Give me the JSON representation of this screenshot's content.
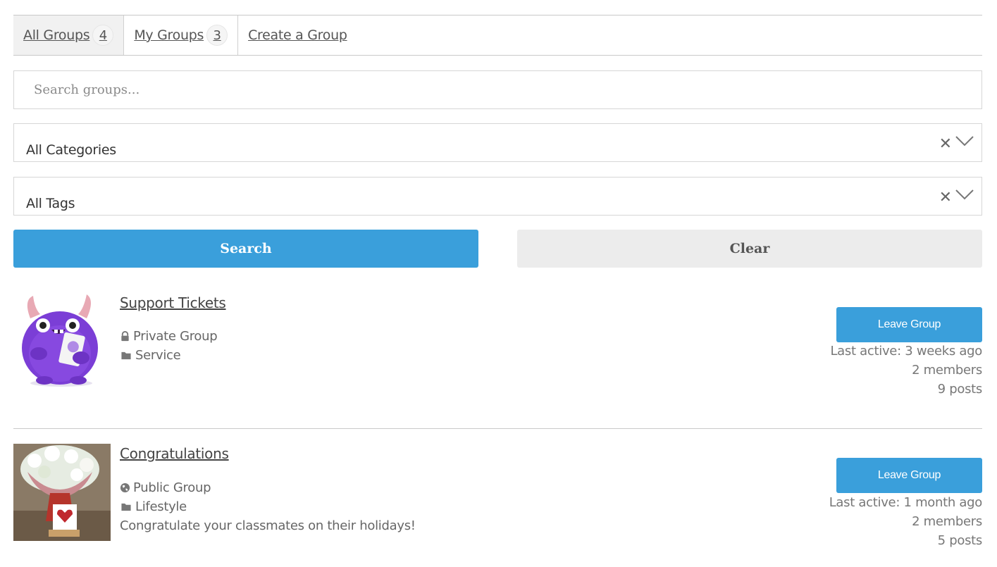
{
  "tabs": [
    {
      "label": "All Groups",
      "count": "4"
    },
    {
      "label": "My Groups",
      "count": "3"
    },
    {
      "label": "Create a Group"
    }
  ],
  "search": {
    "placeholder": "Search groups..."
  },
  "filters": {
    "categories": {
      "value": "All Categories"
    },
    "tags": {
      "value": "All Tags"
    }
  },
  "buttons": {
    "search": "Search",
    "clear": "Clear"
  },
  "groups": [
    {
      "name": "Support Tickets",
      "privacy": "Private Group",
      "privacy_icon": "lock-icon",
      "category": "Service",
      "description": "",
      "leave_label": "Leave Group",
      "last_active": "Last active: 3 weeks ago",
      "members": "2 members",
      "posts": "9 posts"
    },
    {
      "name": "Congratulations",
      "privacy": "Public Group",
      "privacy_icon": "globe-icon",
      "category": "Lifestyle",
      "description": "Congratulate your classmates on their holidays!",
      "leave_label": "Leave Group",
      "last_active": "Last active: 1 month ago",
      "members": "2 members",
      "posts": "5 posts"
    }
  ],
  "colors": {
    "primary": "#3a9fdb",
    "secondary": "#ececec",
    "text": "#555555"
  }
}
